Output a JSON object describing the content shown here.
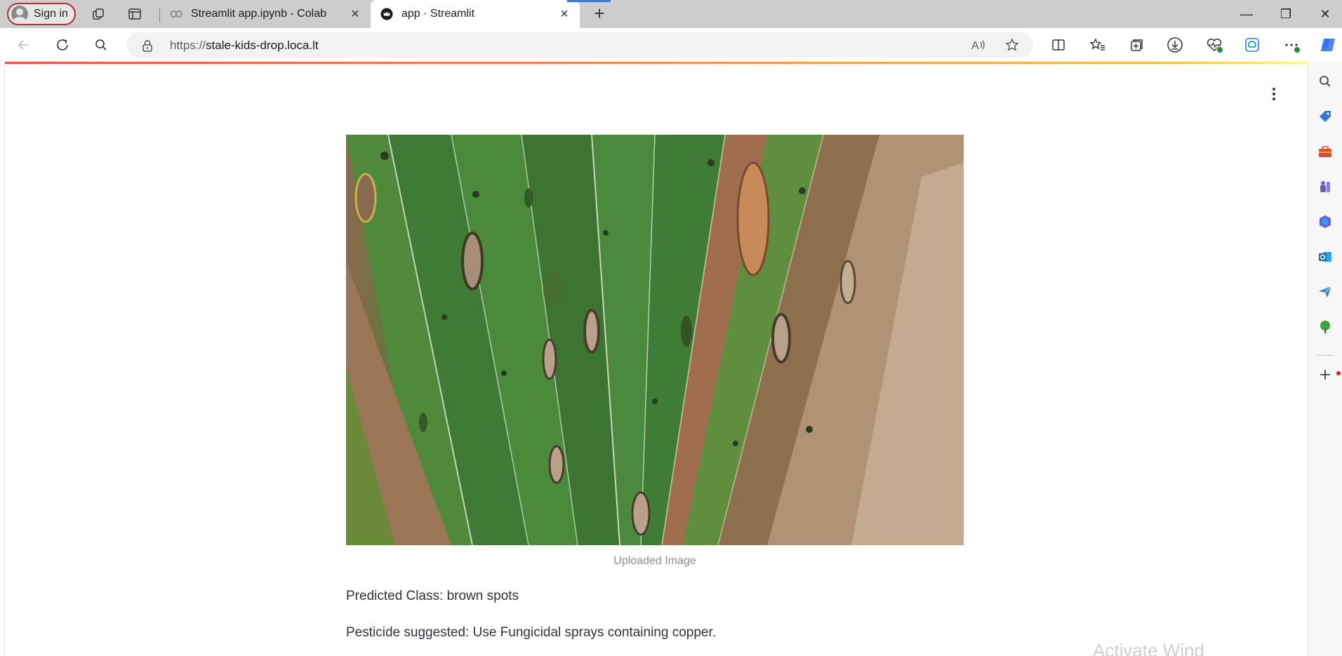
{
  "browser": {
    "profile": {
      "label": "Sign in"
    },
    "tabs": [
      {
        "title": "Streamlit app.ipynb - Colab",
        "active": false
      },
      {
        "title": "app · Streamlit",
        "active": true
      }
    ],
    "address": {
      "scheme": "https://",
      "host": "stale-kids-drop.loca.lt"
    },
    "window_controls": {
      "minimize": "—",
      "restore": "❐",
      "close": "✕"
    },
    "new_tab": "+"
  },
  "page": {
    "image": {
      "alt": "Uploaded Image",
      "caption": "Uploaded Image"
    },
    "predicted_class_text": "Predicted Class: brown spots",
    "pesticide_text": "Pesticide suggested: Use Fungicidal sprays containing copper.",
    "watermark": "Activate Wind"
  },
  "colors": {
    "streamlit_red": "#ff4b4b",
    "streamlit_text": "#31333f",
    "caption": "#8a8d97",
    "tabstrip": "#cdcdcd",
    "signin_border": "#b5302e"
  },
  "sidebar": {
    "icons": [
      "search-icon",
      "tag-icon",
      "toolbox-icon",
      "games-icon",
      "office-icon",
      "outlook-icon",
      "send-icon",
      "tree-icon",
      "add-icon"
    ]
  }
}
